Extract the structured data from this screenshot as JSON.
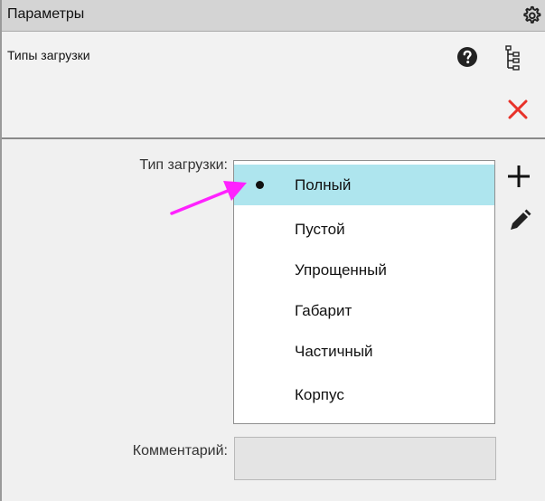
{
  "panel": {
    "title": "Параметры",
    "subheader_label": "Типы загрузки"
  },
  "icons": {
    "settings": "gear-icon",
    "help": "question-circle-icon",
    "tree": "tree-icon",
    "close": "close-icon",
    "add": "plus-icon",
    "edit": "pencil-icon"
  },
  "form": {
    "type_label": "Тип загрузки:",
    "comment_label": "Комментарий:",
    "comment_value": "",
    "options": [
      {
        "label": "Полный",
        "selected": true
      },
      {
        "label": "Пустой",
        "selected": false
      },
      {
        "label": "Упрощенный",
        "selected": false
      },
      {
        "label": "Габарит",
        "selected": false
      },
      {
        "label": "Частичный",
        "selected": false
      },
      {
        "label": "Корпус",
        "selected": false
      }
    ]
  },
  "colors": {
    "selection": "#aee5ee",
    "close": "#e8322a",
    "annotation_arrow": "#ff22ff"
  }
}
